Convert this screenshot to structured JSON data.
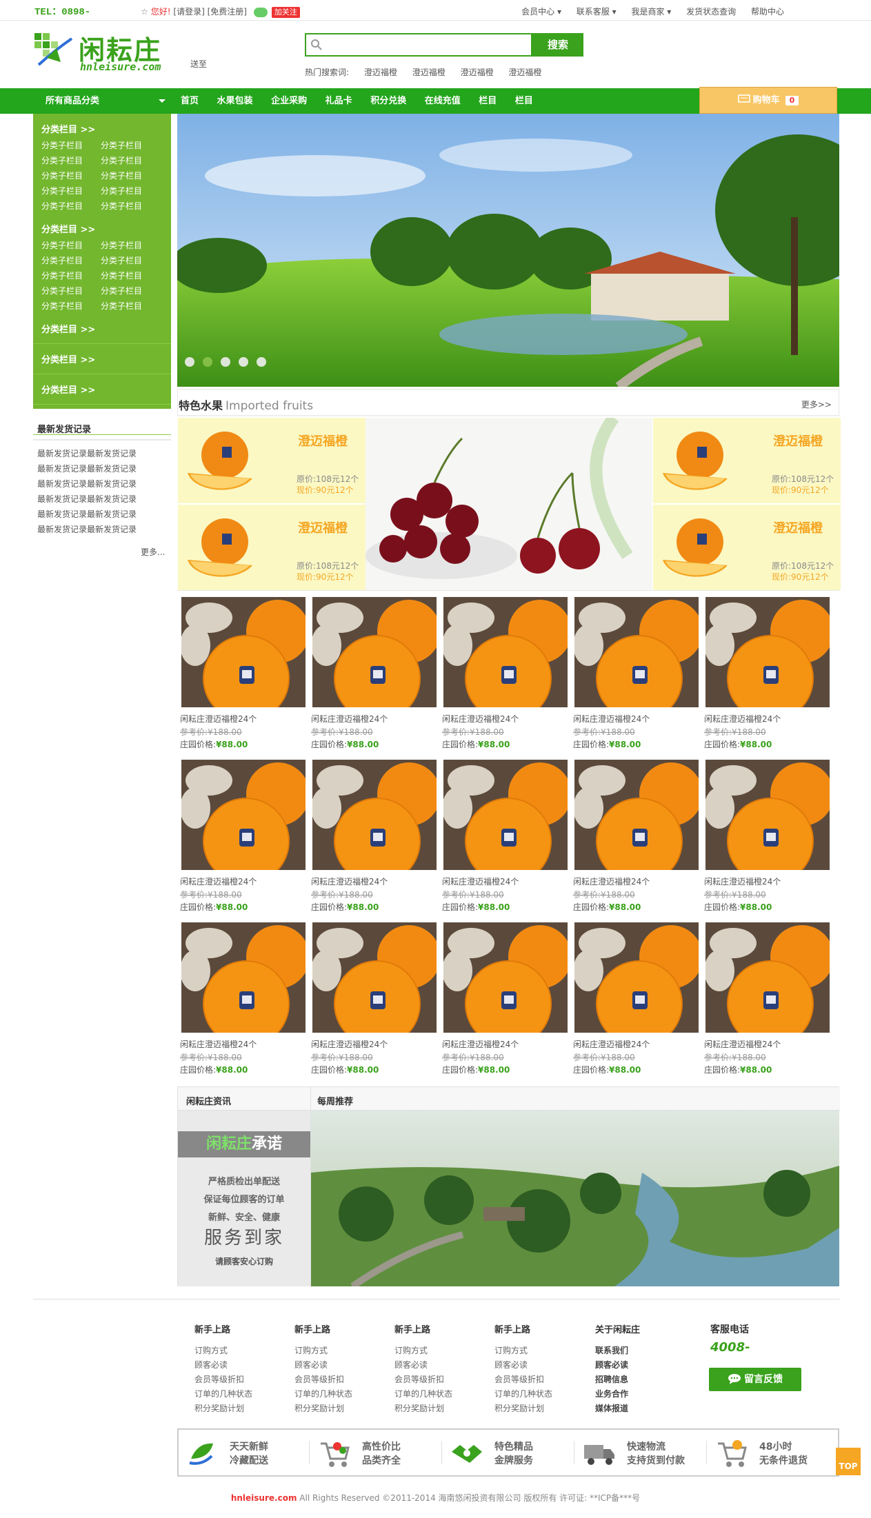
{
  "topbar": {
    "tel": "TEL：0898-",
    "greet_hello": "您好!",
    "login": "[请登录]",
    "register": "[免费注册]",
    "follow": "加关注",
    "links": [
      "会员中心 ▾",
      "联系客服 ▾",
      "我是商家 ▾",
      "发货状态查询",
      "帮助中心"
    ]
  },
  "header": {
    "logo_cn": "闲耘庄",
    "logo_en": "hnleisure.com",
    "tagline": "送至",
    "search_placeholder": "",
    "search_button": "搜索",
    "hot_label": "热门搜索词:",
    "hot_terms": [
      "澄迈福橙",
      "澄迈福橙",
      "澄迈福橙",
      "澄迈福橙"
    ]
  },
  "nav": {
    "all_categories": "所有商品分类",
    "items": [
      "首页",
      "水果包装",
      "企业采购",
      "礼品卡",
      "积分兑换",
      "在线充值",
      "栏目",
      "栏目"
    ],
    "cart_label": "购物车",
    "cart_count": "0"
  },
  "sidebar": {
    "groups": [
      {
        "title": "分类栏目 >>",
        "rows": [
          [
            "分类子栏目",
            "分类子栏目"
          ],
          [
            "分类子栏目",
            "分类子栏目"
          ],
          [
            "分类子栏目",
            "分类子栏目"
          ],
          [
            "分类子栏目",
            "分类子栏目"
          ],
          [
            "分类子栏目",
            "分类子栏目"
          ]
        ]
      },
      {
        "title": "分类栏目 >>",
        "rows": [
          [
            "分类子栏目",
            "分类子栏目"
          ],
          [
            "分类子栏目",
            "分类子栏目"
          ],
          [
            "分类子栏目",
            "分类子栏目"
          ],
          [
            "分类子栏目",
            "分类子栏目"
          ],
          [
            "分类子栏目",
            "分类子栏目"
          ]
        ]
      },
      {
        "title": "分类栏目 >>",
        "rows": []
      },
      {
        "title": "分类栏目 >>",
        "rows": []
      },
      {
        "title": "分类栏目 >>",
        "rows": []
      },
      {
        "title": "分类栏目 >>",
        "rows": []
      }
    ],
    "shipping_title": "最新发货记录",
    "shipping_records": [
      "最新发货记录最新发货记录",
      "最新发货记录最新发货记录",
      "最新发货记录最新发货记录",
      "最新发货记录最新发货记录",
      "最新发货记录最新发货记录",
      "最新发货记录最新发货记录"
    ],
    "more": "更多..."
  },
  "featured": {
    "title": "特色水果",
    "title_en": "Imported fruits",
    "more": "更多>>",
    "promo_name": "澄迈福橙",
    "promo_orig": "原价:108元12个",
    "promo_now": "现价:90元12个"
  },
  "products": {
    "name": "闲耘庄澄迈福橙24个",
    "ref_price": "参考价:¥188.00",
    "price_label": "庄园价格:",
    "price": "¥88.00"
  },
  "news": {
    "tab1": "闲耘庄资讯",
    "tab2": "每周推荐",
    "promise_brand": "闲耘庄",
    "promise_word": "承诺",
    "promise_lines": [
      "严格质检出单配送",
      "保证每位顾客的订单",
      "新鲜、安全、健康"
    ],
    "promise_big": "服务到家",
    "promise_small": "请顾客安心订购"
  },
  "footer": {
    "columns": [
      {
        "title": "新手上路",
        "items": [
          "订购方式",
          "顾客必读",
          "会员等级折扣",
          "订单的几种状态",
          "积分奖励计划"
        ]
      },
      {
        "title": "新手上路",
        "items": [
          "订购方式",
          "顾客必读",
          "会员等级折扣",
          "订单的几种状态",
          "积分奖励计划"
        ]
      },
      {
        "title": "新手上路",
        "items": [
          "订购方式",
          "顾客必读",
          "会员等级折扣",
          "订单的几种状态",
          "积分奖励计划"
        ]
      },
      {
        "title": "新手上路",
        "items": [
          "订购方式",
          "顾客必读",
          "会员等级折扣",
          "订单的几种状态",
          "积分奖励计划"
        ]
      },
      {
        "title": "关于闲耘庄",
        "items": [
          "联系我们",
          "顾客必读",
          "招聘信息",
          "业务合作",
          "媒体报道"
        ]
      }
    ],
    "hotline_title": "客服电话",
    "hotline": "4008-",
    "feedback": "留言反馈",
    "services": [
      {
        "l1": "天天新鲜",
        "l2": "冷藏配送"
      },
      {
        "l1": "高性价比",
        "l2": "品类齐全"
      },
      {
        "l1": "特色精品",
        "l2": "金牌服务"
      },
      {
        "l1": "快速物流",
        "l2": "支持货到付款"
      },
      {
        "l1": "48小时",
        "l2": "无条件退货"
      }
    ],
    "top": "TOP",
    "site": "hnleisure.com",
    "rights": "All Rights Reserved ©2011-2014  海南悠闲投资有限公司 版权所有  许可证: **ICP备***号"
  }
}
